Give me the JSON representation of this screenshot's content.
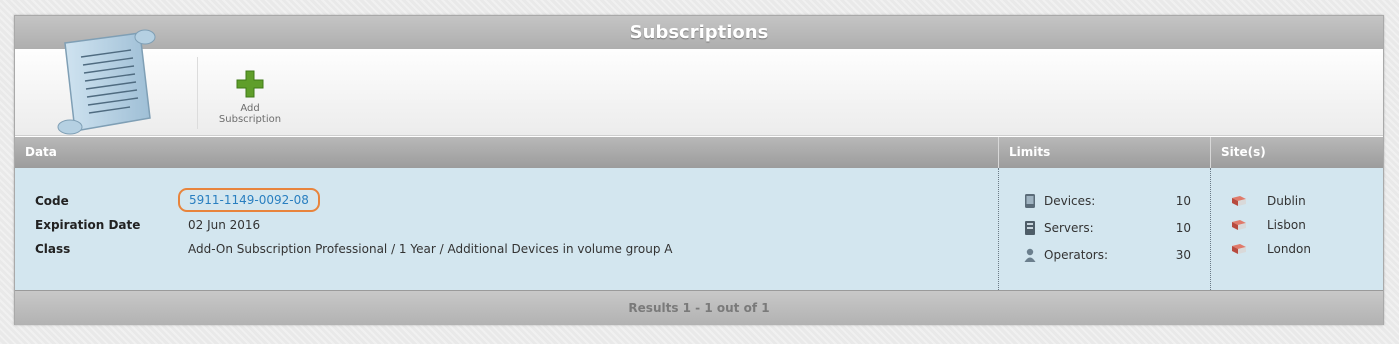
{
  "title": "Subscriptions",
  "toolbar": {
    "add_label_line1": "Add",
    "add_label_line2": "Subscription"
  },
  "columns": {
    "data": "Data",
    "limits": "Limits",
    "sites": "Site(s)"
  },
  "subscription": {
    "code_label": "Code",
    "code_value": "5911-1149-0092-08",
    "expiration_label": "Expiration Date",
    "expiration_value": "02 Jun 2016",
    "class_label": "Class",
    "class_value": "Add-On Subscription Professional / 1 Year / Additional Devices in volume group A"
  },
  "limits": [
    {
      "label": "Devices:",
      "value": "10",
      "icon": "device-icon"
    },
    {
      "label": "Servers:",
      "value": "10",
      "icon": "server-icon"
    },
    {
      "label": "Operators:",
      "value": "30",
      "icon": "operator-icon"
    }
  ],
  "sites": [
    {
      "name": "Dublin",
      "icon": "site-books-icon"
    },
    {
      "name": "Lisbon",
      "icon": "site-books-icon"
    },
    {
      "name": "London",
      "icon": "site-books-icon"
    }
  ],
  "footer": {
    "results": "Results 1 - 1 out of 1"
  },
  "colors": {
    "accent_highlight": "#e8843c",
    "link": "#2a7fc0",
    "row_bg": "#d3e6ef"
  }
}
